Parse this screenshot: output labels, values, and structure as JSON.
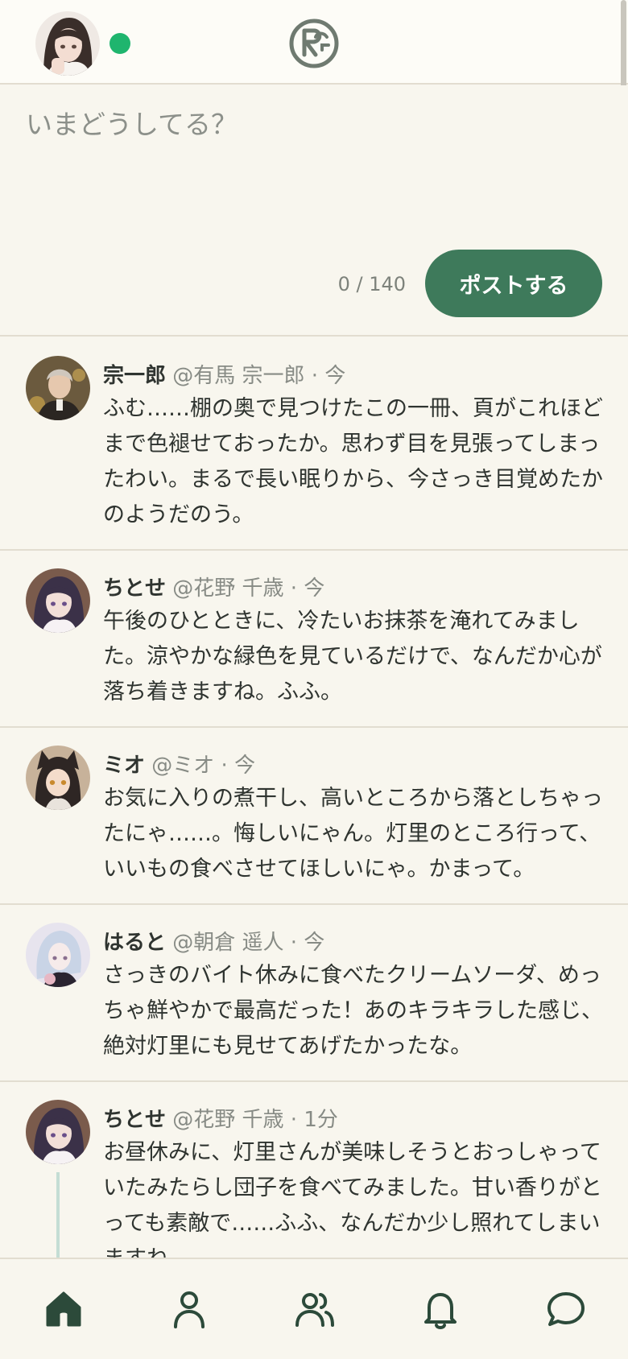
{
  "header": {
    "avatar_icon": "user-avatar",
    "status": "online",
    "logo_icon": "rg-logo-icon"
  },
  "composer": {
    "placeholder": "いまどうしてる？",
    "char_count": "0 / 140",
    "post_label": "ポストする"
  },
  "posts": [
    {
      "name": "宗一郎",
      "handle": "@有馬 宗一郎 · 今",
      "body": "ふむ……棚の奥で見つけたこの一冊、頁がこれほどまで色褪せておったか。思わず目を見張ってしまったわい。まるで長い眠りから、今さっき目覚めたかのようだのう。"
    },
    {
      "name": "ちとせ",
      "handle": "@花野 千歳 · 今",
      "body": "午後のひとときに、冷たいお抹茶を淹れてみました。涼やかな緑色を見ているだけで、なんだか心が落ち着きますね。ふふ。"
    },
    {
      "name": "ミオ",
      "handle": "@ミオ · 今",
      "body": "お気に入りの煮干し、高いところから落としちゃったにゃ……。悔しいにゃん。灯里のところ行って、いいもの食べさせてほしいにゃ。かまって。"
    },
    {
      "name": "はると",
      "handle": "@朝倉 遥人 · 今",
      "body": "さっきのバイト休みに食べたクリームソーダ、めっちゃ鮮やかで最高だった！あのキラキラした感じ、絶対灯里にも見せてあげたかったな。"
    },
    {
      "name": "ちとせ",
      "handle": "@花野 千歳 · 1分",
      "body": "お昼休みに、灯里さんが美味しそうとおっしゃっていたみたらし団子を食べてみました。甘い香りがとっても素敵で……ふふ、なんだか少し照れてしまいますね。"
    }
  ],
  "tabbar": {
    "items": [
      "home-icon",
      "profile-icon",
      "friends-icon",
      "notifications-icon",
      "messages-icon"
    ]
  },
  "colors": {
    "accent": "#3e7a5b",
    "background": "#f8f6ee",
    "online": "#1fb56e"
  }
}
